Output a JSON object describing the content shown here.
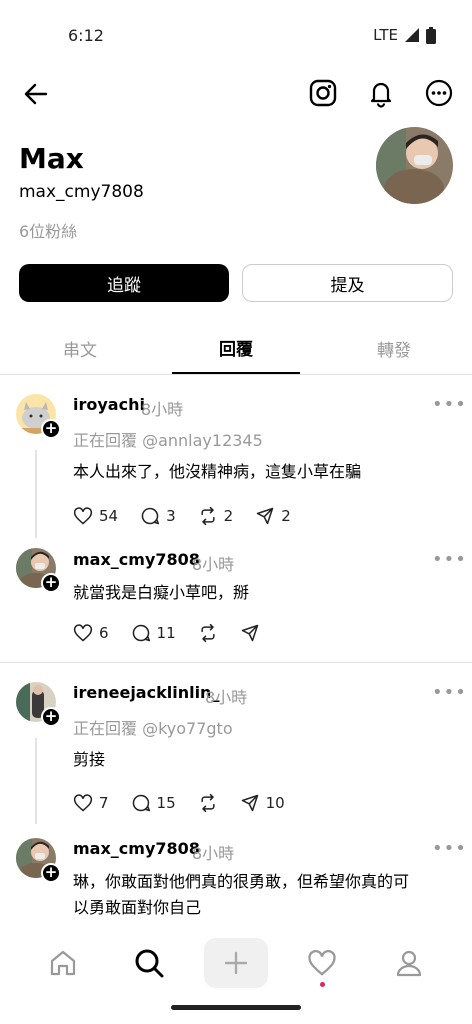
{
  "status": {
    "time": "6:12",
    "network": "LTE"
  },
  "topbar": {
    "icons": [
      "back-arrow-icon",
      "instagram-icon",
      "bell-icon",
      "more-circle-icon"
    ]
  },
  "profile": {
    "name": "Max",
    "handle": "max_cmy7808",
    "followers": "6位粉絲",
    "follow_label": "追蹤",
    "mention_label": "提及"
  },
  "tabs": [
    {
      "label": "串文",
      "active": false
    },
    {
      "label": "回覆",
      "active": true
    },
    {
      "label": "轉發",
      "active": false
    }
  ],
  "threads": [
    {
      "parent": {
        "username": "iroyachi",
        "time": "8小時",
        "reply_to": "正在回覆 @annlay12345",
        "text": "本人出來了，他沒精神病，這隻小草在騙",
        "likes": "54",
        "comments": "3",
        "reposts": "2",
        "shares": "2"
      },
      "reply": {
        "username": "max_cmy7808",
        "time": "8小時",
        "text": "就當我是白癡小草吧，掰",
        "likes": "6",
        "comments": "11"
      }
    },
    {
      "parent": {
        "username": "ireneejacklinlin_",
        "time": "8小時",
        "reply_to": "正在回覆 @kyo77gto",
        "text": "剪接",
        "likes": "7",
        "comments": "15",
        "shares": "10"
      },
      "reply": {
        "username": "max_cmy7808",
        "time": "8小時",
        "text_line1": "琳，你敢面對他們真的很勇敢，但希望你真的可",
        "text_line2": "以勇敢面對你自己"
      }
    }
  ],
  "bottom_nav": [
    "home-icon",
    "search-icon",
    "plus-icon",
    "heart-icon",
    "profile-icon"
  ],
  "colors": {
    "accent": "#000000",
    "muted": "#999999",
    "notification_dot": "#e0245e"
  }
}
